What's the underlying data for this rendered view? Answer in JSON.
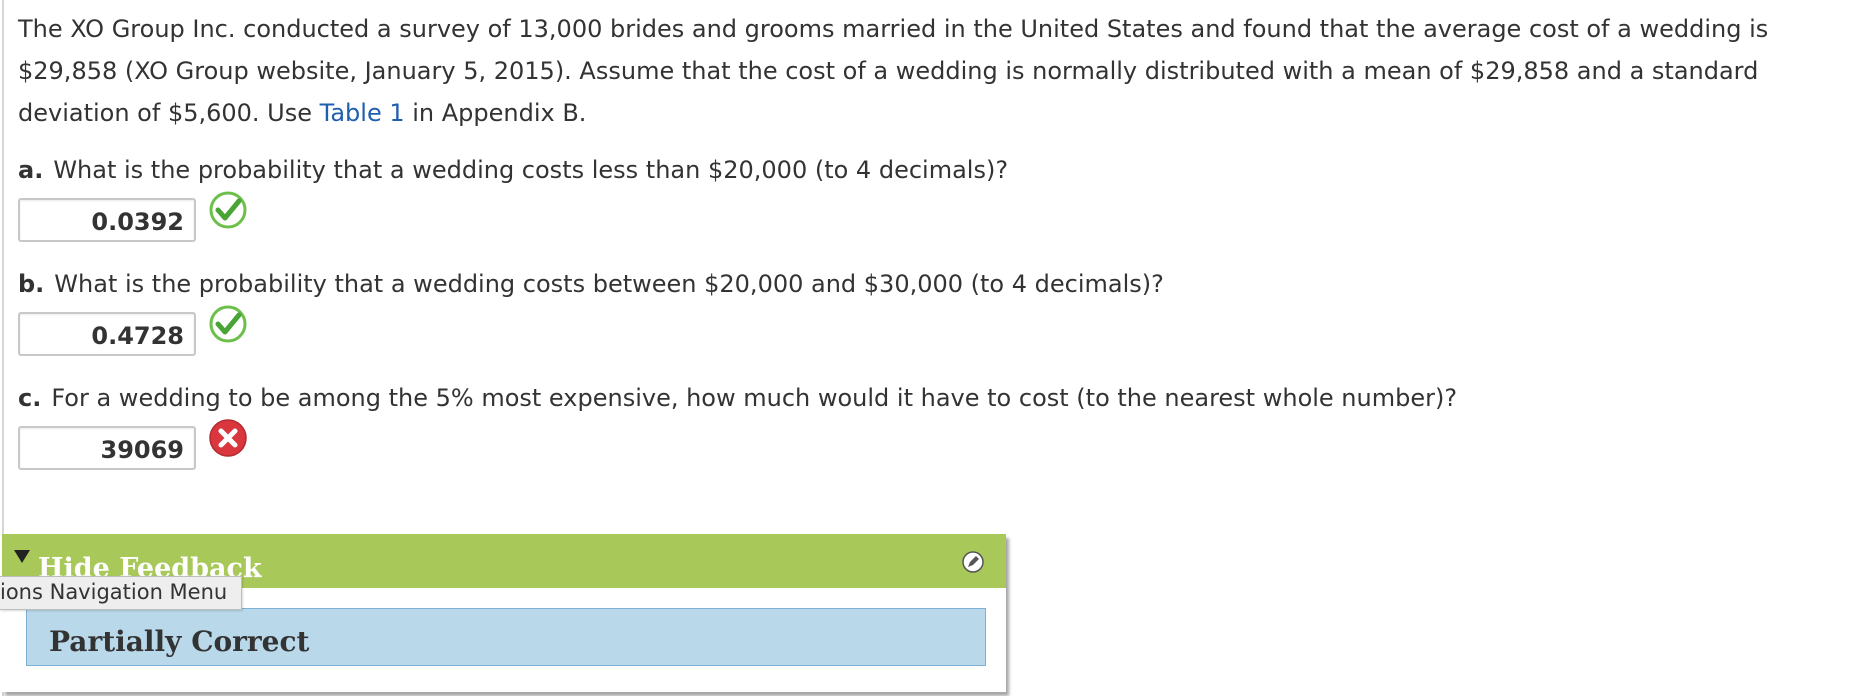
{
  "problem": {
    "text_before_link": "The XO Group Inc. conducted a survey of 13,000 brides and grooms married in the United States and found that the average cost of a wedding is $29,858 (XO Group website, January 5, 2015). Assume that the cost of a wedding is normally distributed with a mean of $29,858 and a standard deviation of $5,600. Use ",
    "link_text": "Table 1",
    "text_after_link": " in Appendix B."
  },
  "parts": [
    {
      "letter": "a.",
      "question": "What is the probability that a wedding costs less than $20,000 (to 4 decimals)?",
      "answer": "0.0392",
      "status": "correct",
      "status_icon": "check-circle-icon",
      "status_color": "#6cc04a"
    },
    {
      "letter": "b.",
      "question": "What is the probability that a wedding costs between $20,000 and $30,000 (to 4 decimals)?",
      "answer": "0.4728",
      "status": "correct",
      "status_icon": "check-circle-icon",
      "status_color": "#6cc04a"
    },
    {
      "letter": "c.",
      "question": "For a wedding to be among the 5% most expensive, how much would it have to cost (to the nearest whole number)?",
      "answer": "39069",
      "status": "incorrect",
      "status_icon": "x-circle-icon",
      "status_color": "#d9363e"
    }
  ],
  "feedback": {
    "toggle_label": "Hide Feedback",
    "result_text": "Partially Correct",
    "header_color": "#a8c95a",
    "result_bg_color": "#b9d9ea"
  },
  "nav_tooltip": {
    "text": "ions Navigation Menu"
  }
}
